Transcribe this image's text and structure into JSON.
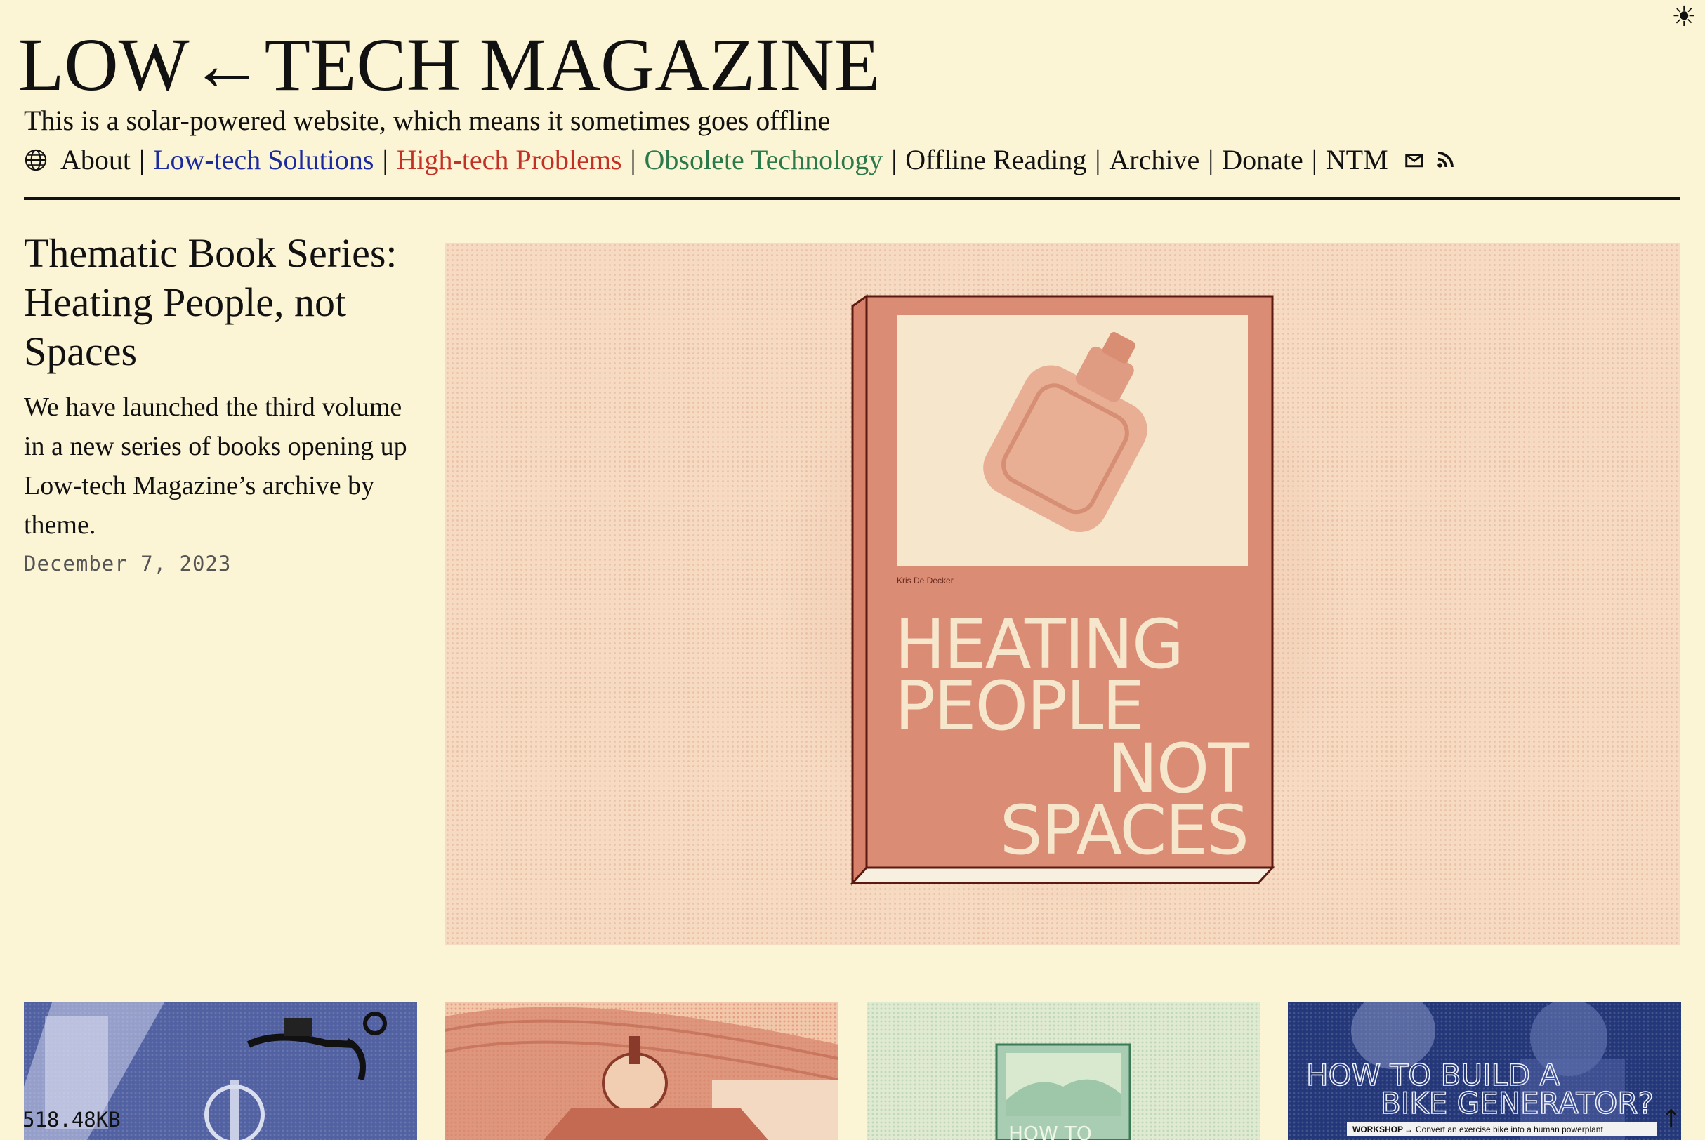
{
  "header": {
    "site_title": "LOW←TECH MAGAZINE",
    "tagline": "This is a solar-powered website, which means it sometimes goes offline",
    "theme_toggle_icon": "☀"
  },
  "nav": {
    "items": [
      {
        "label": "About",
        "color": "#111111"
      },
      {
        "label": "Low-tech Solutions",
        "color": "#1c2aa0"
      },
      {
        "label": "High-tech Problems",
        "color": "#c33025"
      },
      {
        "label": "Obsolete Technology",
        "color": "#2c7a4c"
      },
      {
        "label": "Offline Reading",
        "color": "#111111"
      },
      {
        "label": "Archive",
        "color": "#111111"
      },
      {
        "label": "Donate",
        "color": "#111111"
      },
      {
        "label": "NTM",
        "color": "#111111"
      }
    ],
    "separator": "|",
    "icons": [
      "globe-icon",
      "mail-icon",
      "rss-icon"
    ]
  },
  "featured": {
    "title": "Thematic Book Series: Heating People, not Spaces",
    "summary": "We have launched the third volume in a new series of books opening up Low-tech Magazine’s archive by theme.",
    "date": "December 7, 2023",
    "cover": {
      "author": "Kris De Decker",
      "lines": [
        "HEATING",
        "PEOPLE",
        "NOT",
        "SPACES"
      ]
    }
  },
  "thumbnails": {
    "t3_cover_text": "HOW TO",
    "t4_heading_1": "HOW TO BUILD A",
    "t4_heading_2": "BIKE GENERATOR?",
    "t4_workshop": "WORKSHOP",
    "t4_caption": "Convert an exercise bike into a human powerplant"
  },
  "footer": {
    "page_size": "518.48KB",
    "to_top_icon": "↑"
  },
  "colors": {
    "background": "#fcf5d5",
    "accent_blue": "#1c2aa0",
    "accent_red": "#c33025",
    "accent_green": "#2c7a4c"
  }
}
